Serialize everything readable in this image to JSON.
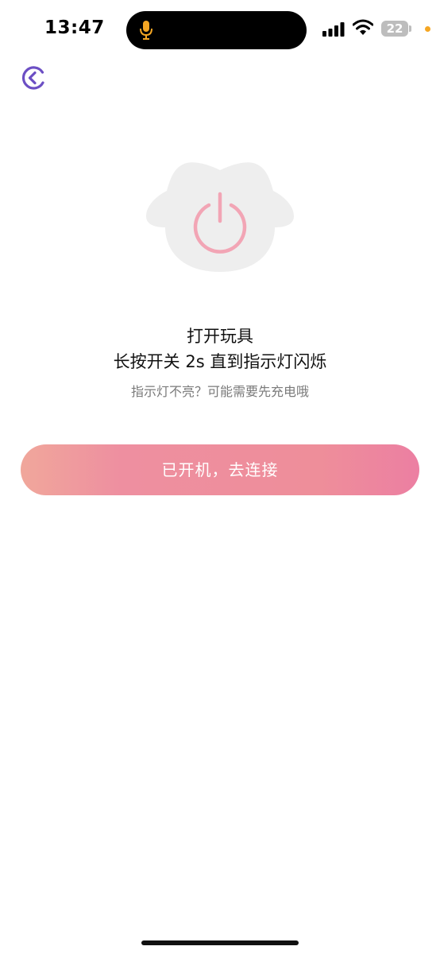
{
  "status_bar": {
    "time": "13:47",
    "battery_level": "22",
    "icons": [
      "microphone-icon",
      "cellular-signal-icon",
      "wifi-icon",
      "battery-icon"
    ],
    "colors": {
      "mic": "#f5a623",
      "privacy_dot": "#f5a623"
    }
  },
  "nav": {
    "back_icon": "back-arrow-icon",
    "back_color": "#6c4fc4"
  },
  "illustration": {
    "icon": "power-icon",
    "body_color": "#eeeeee",
    "icon_color": "#f2a5b5"
  },
  "content": {
    "title": "打开玩具",
    "instruction": "长按开关 2s 直到指示灯闪烁",
    "hint": "指示灯不亮？可能需要先充电哦"
  },
  "actions": {
    "connect_label": "已开机，去连接",
    "gradient": [
      "#f0a79b",
      "#ee8fa0",
      "#ec7fa2"
    ]
  }
}
